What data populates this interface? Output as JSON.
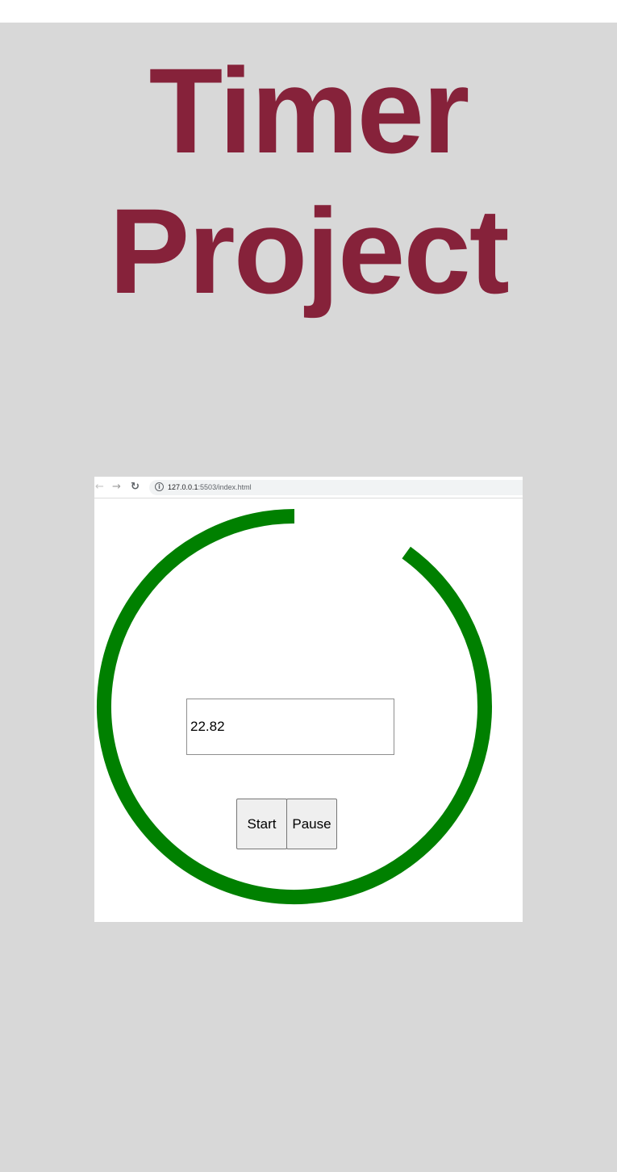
{
  "page": {
    "title_line_1": "Timer",
    "title_line_2": "Project",
    "title_color": "#86223a",
    "background_color": "#d8d8d8"
  },
  "browser": {
    "back_icon": "arrow-left-icon",
    "forward_icon": "arrow-right-icon",
    "reload_icon": "reload-icon",
    "info_icon": "info-icon",
    "url_host": "127.0.0.1",
    "url_rest": ":5503/index.html"
  },
  "timer": {
    "ring_color": "#008000",
    "remaining_fraction": 0.9,
    "input_value": "22.82",
    "start_label": "Start",
    "pause_label": "Pause"
  }
}
